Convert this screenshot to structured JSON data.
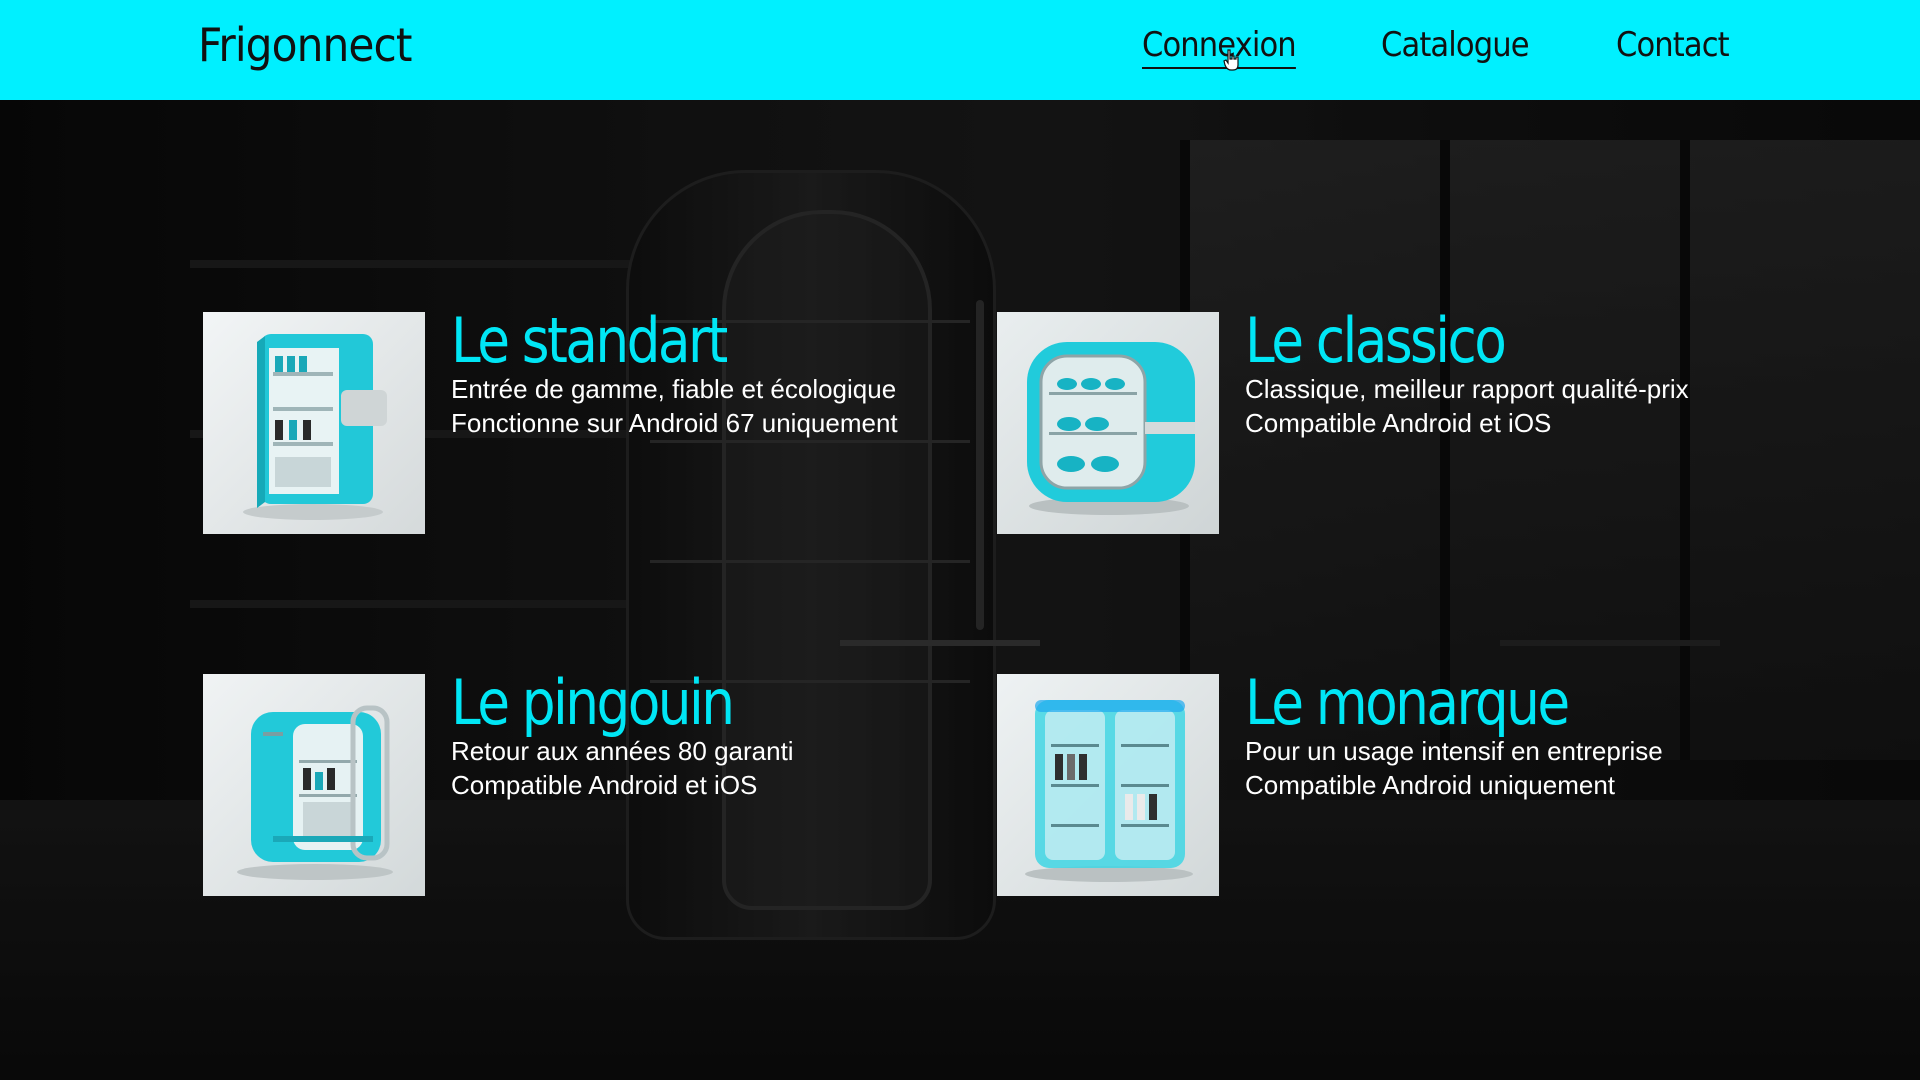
{
  "header": {
    "logo": "Frigonnect",
    "nav": [
      {
        "label": "Connexion"
      },
      {
        "label": "Catalogue"
      },
      {
        "label": "Contact"
      }
    ]
  },
  "colors": {
    "header_background": "#00f0ff",
    "accent": "#00e6f5",
    "text": "#ffffff"
  },
  "products": [
    {
      "title": "Le standart",
      "line1": "Entrée de gamme, fiable et écologique",
      "line2": "Fonctionne sur Android 67 uniquement",
      "image": "fridge-open-door-image"
    },
    {
      "title": "Le classico",
      "line1": "Classique, meilleur rapport qualité-prix",
      "line2": "Compatible Android et iOS",
      "image": "fridge-rounded-image"
    },
    {
      "title": "Le pingouin",
      "line1": "Retour aux années 80 garanti",
      "line2": "Compatible Android et iOS",
      "image": "fridge-retro-image"
    },
    {
      "title": "Le monarque",
      "line1": "Pour un usage intensif en entreprise",
      "line2": "Compatible Android uniquement",
      "image": "fridge-transparent-image"
    }
  ]
}
